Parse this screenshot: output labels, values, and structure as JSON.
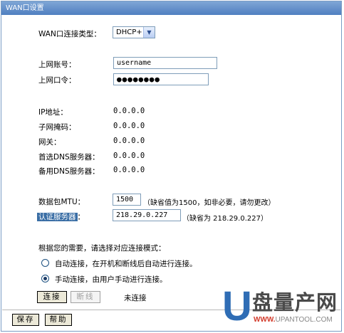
{
  "window": {
    "title": "WAN口设置"
  },
  "connection_type": {
    "label": "WAN口连接类型：",
    "value": "DHCP+"
  },
  "account": {
    "label": "上网账号：",
    "value": "username"
  },
  "password": {
    "label": "上网口令：",
    "value": "●●●●●●●●"
  },
  "status": [
    {
      "label": "IP地址：",
      "value": "0.0.0.0"
    },
    {
      "label": "子网掩码：",
      "value": "0.0.0.0"
    },
    {
      "label": "网关：",
      "value": "0.0.0.0"
    },
    {
      "label": "首选DNS服务器：",
      "value": "0.0.0.0"
    },
    {
      "label": "备用DNS服务器：",
      "value": "0.0.0.0"
    }
  ],
  "mtu": {
    "label": "数据包MTU：",
    "value": "1500",
    "hint": "（缺省值为1500，如非必要，请勿更改）"
  },
  "auth_server": {
    "label": "认证服务器",
    "colon": "：",
    "value": "218.29.0.227",
    "hint": "（缺省为 218.29.0.227）"
  },
  "mode": {
    "prompt": "根据您的需要，请选择对应连接模式：",
    "auto_label": "自动连接，在开机和断线后自动进行连接。",
    "manual_label": "手动连接，由用户手动进行连接。",
    "selected": "manual"
  },
  "actions": {
    "connect_label": "连接",
    "disconnect_label": "断线",
    "connection_status": "未连接",
    "save_label": "保存",
    "help_label": "帮助"
  },
  "watermark": {
    "brand_letter": "U",
    "brand_text": "盘量产网",
    "url_red": "WWW.",
    "url_rest": "UPANTOOL.COM"
  }
}
